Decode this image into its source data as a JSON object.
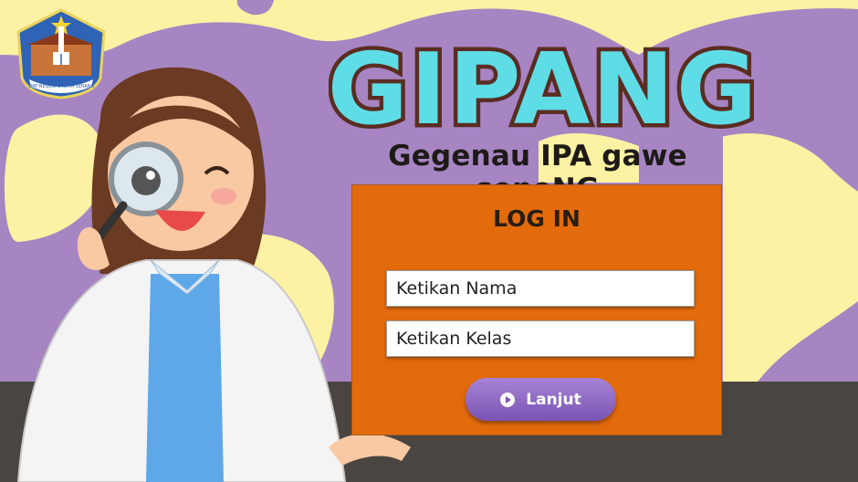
{
  "app": {
    "title": "GIPANG",
    "subtitle": "Gegenau IPA gawe seneNG"
  },
  "logo": {
    "text": "SMP NEGERI 3 KOTA SERANG"
  },
  "login": {
    "heading": "LOG IN",
    "name_placeholder": "Ketikan Nama",
    "class_placeholder": "Ketikan Kelas",
    "submit_label": "Lanjut"
  },
  "colors": {
    "background": "#fdf1a3",
    "blob": "#a785c3",
    "panel": "#e36b0c",
    "title_fill": "#5fdde6",
    "title_outline": "#5a2d22",
    "button": "#8a64c0"
  }
}
